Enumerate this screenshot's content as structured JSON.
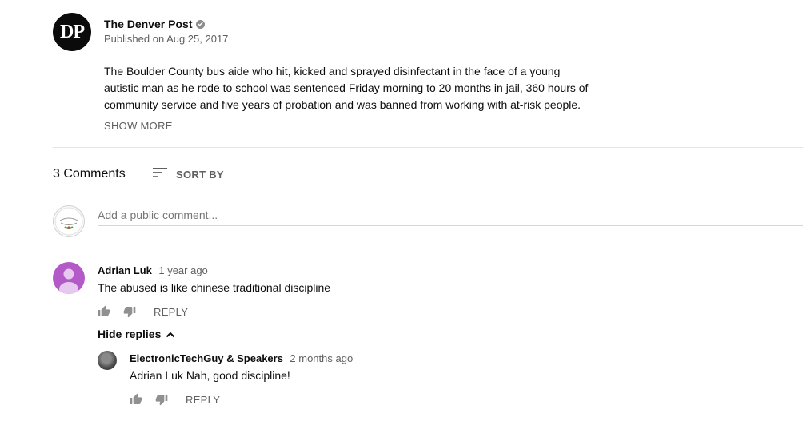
{
  "video": {
    "channel_name": "The Denver Post",
    "channel_logo_text": "DP",
    "published": "Published on Aug 25, 2017",
    "description_lines": [
      "The Boulder County bus aide who hit, kicked and sprayed disinfectant in the face of a young",
      "autistic man as he rode to school was sentenced Friday morning to 20 months in jail, 360 hours of",
      "community service and five years of probation and was banned from working with at-risk people."
    ],
    "show_more": "SHOW MORE"
  },
  "comments_header": {
    "count": "3 Comments",
    "sort_label": "SORT BY"
  },
  "add_comment": {
    "placeholder": "Add a public comment..."
  },
  "comments": [
    {
      "author": "Adrian Luk",
      "time": "1 year ago",
      "text": "The abused is like chinese traditional discipline",
      "reply_label": "REPLY",
      "hide_replies": "Hide replies",
      "replies": [
        {
          "author": "ElectronicTechGuy & Speakers",
          "time": "2 months ago",
          "text": "Adrian Luk Nah, good discipline!",
          "reply_label": "REPLY"
        }
      ]
    }
  ],
  "colors": {
    "text_primary": "#0d0d0d",
    "text_secondary": "#606060",
    "avatar_purple": "#b45ac8"
  },
  "icons": [
    "verified-icon",
    "sort-icon",
    "thumbs-up-icon",
    "thumbs-down-icon",
    "chevron-up-icon"
  ]
}
